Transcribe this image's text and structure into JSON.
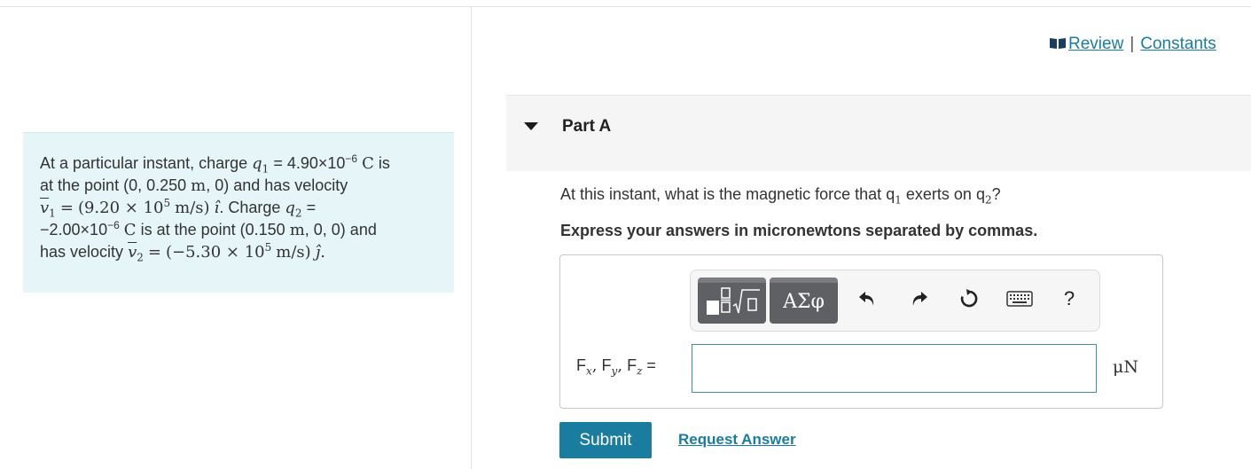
{
  "header_links": {
    "review": "Review",
    "separator": "|",
    "constants": "Constants"
  },
  "problem": {
    "l1_a": "At a particular instant, charge",
    "q": "q",
    "sub1": "1",
    "sub2": "2",
    "l1_b": "= 4.90×10",
    "l1_exp": "−6",
    "unit_C": "C",
    "l1_c": "is",
    "l2_a": "at the point (0, 0.250",
    "unit_m": "m",
    "l2_b": ", 0) and has velocity",
    "v": "v",
    "l3_eq": "=",
    "l3_val": "(9.20 × 10",
    "l3_exp": "5",
    "l3_unit": "m/s)",
    "hat_i": "ı̂",
    "l3_b": ". Charge",
    "l3_c": "=",
    "l4_a": "−2.00×10",
    "l4_exp": "−6",
    "l4_b": "is at the point (0.150",
    "l4_c": ", 0, 0) and",
    "l5_a": "has velocity",
    "l5_eq": "=",
    "l5_val": "(−5.30 × 10",
    "l5_exp": "5",
    "l5_unit": "m/s)",
    "hat_j": "ȷ̂",
    "l5_end": "."
  },
  "part": {
    "title": "Part A",
    "question_a": "At this instant, what is the magnetic force that",
    "question_q": "q",
    "question_s1": "1",
    "question_b": "exerts on",
    "question_s2": "2",
    "question_end": "?",
    "instruction": "Express your answers in micronewtons separated by commas."
  },
  "toolbar": {
    "greek_label": "ΑΣφ",
    "help_label": "?"
  },
  "answer": {
    "F": "F",
    "sx": "x",
    "sy": "y",
    "sz": "z",
    "comma": ",",
    "equals": "=",
    "value": "",
    "unit": "μN"
  },
  "actions": {
    "submit": "Submit",
    "request": "Request Answer"
  },
  "colors": {
    "accent": "#1a7da0",
    "problem_bg": "#e6f5f7",
    "toolbar_button": "#5e6063"
  }
}
